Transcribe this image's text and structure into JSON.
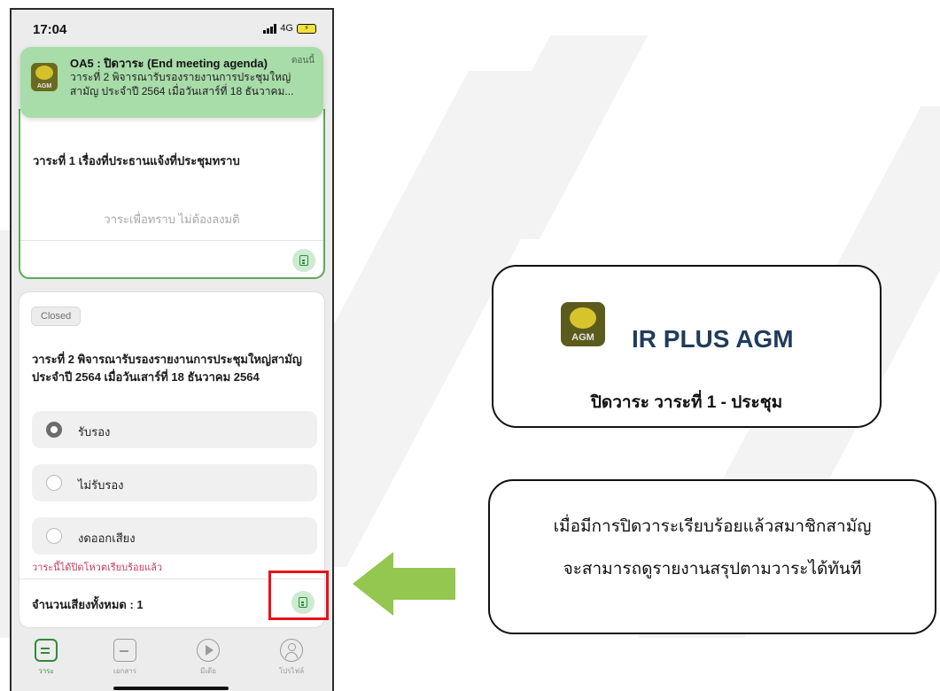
{
  "status_bar": {
    "time": "17:04",
    "network": "4G"
  },
  "notification": {
    "title": "OA5 : ปิดวาระ (End meeting agenda)",
    "when": "ตอนนี้",
    "body": "วาระที่ 2 พิจารณารับรองรายงานการประชุมใหญ่สามัญ ประจำปี 2564 เมื่อวันเสาร์ที่ 18 ธันวาคม...",
    "logo_text": "AGM"
  },
  "agenda1": {
    "title": "วาระที่ 1 เรื่องที่ประธานแจ้งที่ประชุมทราบ",
    "note": "วาระเพื่อทราบ ไม่ต้องลงมติ"
  },
  "agenda2": {
    "status": "Closed",
    "title": "วาระที่ 2 พิจารณารับรองรายงานการประชุมใหญ่สามัญ ประจำปี 2564 เมื่อวันเสาร์ที่ 18 ธันวาคม 2564",
    "options": [
      {
        "label": "รับรอง",
        "selected": true
      },
      {
        "label": "ไม่รับรอง",
        "selected": false
      },
      {
        "label": "งดออกเสียง",
        "selected": false
      }
    ],
    "closed_message": "วาระนี้ได้ปิดโหวตเรียบร้อยแล้ว",
    "total_votes": "จำนวนเสียงทั้งหมด : 1"
  },
  "tabs": [
    {
      "label": "วาระ",
      "icon": "agenda-icon",
      "active": true
    },
    {
      "label": "เอกสาร",
      "icon": "folder-icon",
      "active": false
    },
    {
      "label": "มีเดีย",
      "icon": "play-icon",
      "active": false
    },
    {
      "label": "โปรไฟล์",
      "icon": "profile-icon",
      "active": false
    }
  ],
  "callout_app": {
    "logo_text": "AGM",
    "name": "IR PLUS AGM",
    "subtitle": "ปิดวาระ วาระที่ 1 - ประชุม"
  },
  "callout_info": {
    "line1": "เมื่อมีการปิดวาระเรียบร้อยแล้วสมาชิกสามัญ",
    "line2": "จะสามารถดูรายงานสรุปตามวาระได้ทันที"
  },
  "colors": {
    "accent_green": "#2f8a3c",
    "notification_bg": "#a8dca9",
    "highlight_red": "#e8121a",
    "arrow_green": "#93c74f",
    "closed_message": "#c8395d",
    "app_name": "#1f3c5a"
  }
}
